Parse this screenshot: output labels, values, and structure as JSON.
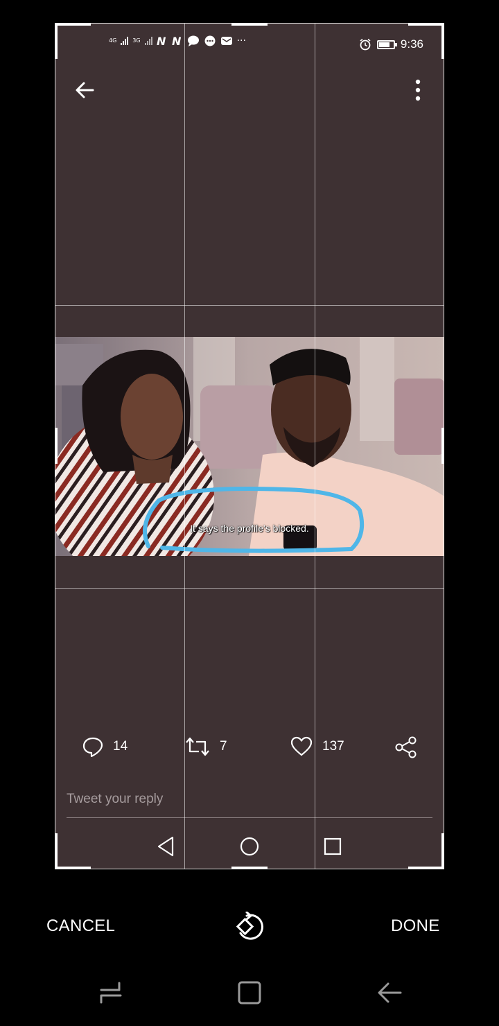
{
  "inner_screenshot": {
    "status_bar": {
      "network_1": "4G",
      "network_2": "3G",
      "time": "9:36"
    },
    "photo": {
      "subtitle": "It says the profile's blocked."
    },
    "actions": {
      "reply_count": "14",
      "retweet_count": "7",
      "like_count": "137"
    },
    "reply_placeholder": "Tweet your reply"
  },
  "toolbar": {
    "cancel_label": "CANCEL",
    "done_label": "DONE",
    "rotate_icon": "rotate-icon"
  },
  "colors": {
    "background": "#000000",
    "canvas": "#3e3133",
    "highlight_circle": "#4fb6e8"
  }
}
